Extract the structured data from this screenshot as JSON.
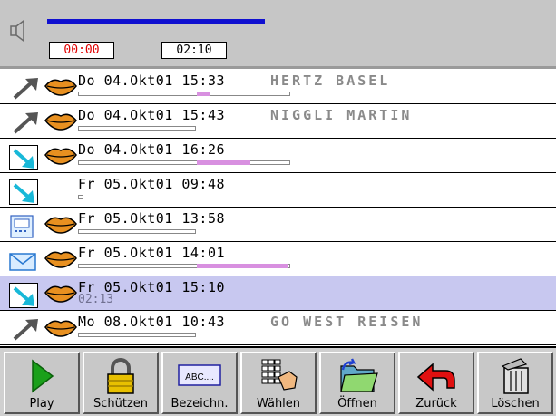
{
  "player": {
    "current_time": "00:00",
    "total_time": "02:10",
    "progress": 0.0,
    "speaker_icon": "speaker-icon",
    "colors": {
      "current_time": "#e00000",
      "progress_bar": "#1010d0"
    }
  },
  "messages": [
    {
      "type_icon": "outgoing-arrow-icon",
      "voice_icon": "lips-icon",
      "day": "Do",
      "date": "04.Okt01",
      "time": "15:33",
      "name": "HERTZ BASEL",
      "subtitle": "",
      "bar_level": 0.06,
      "selected": false
    },
    {
      "type_icon": "outgoing-arrow-icon",
      "voice_icon": "lips-icon",
      "day": "Do",
      "date": "04.Okt01",
      "time": "15:43",
      "name": "NIGGLI MARTIN",
      "subtitle": "",
      "bar_level": 0.0,
      "selected": false
    },
    {
      "type_icon": "incoming-arrow-icon",
      "voice_icon": "lips-icon",
      "day": "Do",
      "date": "04.Okt01",
      "time": "16:26",
      "name": "",
      "subtitle": "",
      "bar_level": 0.25,
      "selected": false
    },
    {
      "type_icon": "incoming-arrow-icon",
      "voice_icon": "",
      "day": "Fr",
      "date": "05.Okt01",
      "time": "09:48",
      "name": "",
      "subtitle": "",
      "bar_level": 0.0,
      "selected": false
    },
    {
      "type_icon": "fax-icon",
      "voice_icon": "lips-icon",
      "day": "Fr",
      "date": "05.Okt01",
      "time": "13:58",
      "name": "",
      "subtitle": "",
      "bar_level": 0.0,
      "selected": false
    },
    {
      "type_icon": "envelope-icon",
      "voice_icon": "lips-icon",
      "day": "Fr",
      "date": "05.Okt01",
      "time": "14:01",
      "name": "",
      "subtitle": "",
      "bar_level": 0.43,
      "selected": false
    },
    {
      "type_icon": "incoming-arrow-icon",
      "voice_icon": "lips-icon",
      "day": "Fr",
      "date": "05.Okt01",
      "time": "15:10",
      "name": "",
      "subtitle": "02:13",
      "bar_level": 0.0,
      "selected": true
    },
    {
      "type_icon": "outgoing-arrow-icon",
      "voice_icon": "lips-icon",
      "day": "Mo",
      "date": "08.Okt01",
      "time": "10:43",
      "name": "GO WEST REISEN",
      "subtitle": "",
      "bar_level": 0.0,
      "selected": false
    }
  ],
  "toolbar": {
    "buttons": [
      {
        "id": "play",
        "label": "Play",
        "icon": "play-icon"
      },
      {
        "id": "protect",
        "label": "Schützen",
        "icon": "padlock-icon"
      },
      {
        "id": "name",
        "label": "Bezeichn.",
        "icon": "label-field-icon",
        "icon_text": "ABC...."
      },
      {
        "id": "dial",
        "label": "Wählen",
        "icon": "keypad-hand-icon"
      },
      {
        "id": "open",
        "label": "Öffnen",
        "icon": "open-folder-icon"
      },
      {
        "id": "back",
        "label": "Zurück",
        "icon": "back-arrow-icon"
      },
      {
        "id": "delete",
        "label": "Löschen",
        "icon": "trash-can-icon"
      }
    ]
  }
}
